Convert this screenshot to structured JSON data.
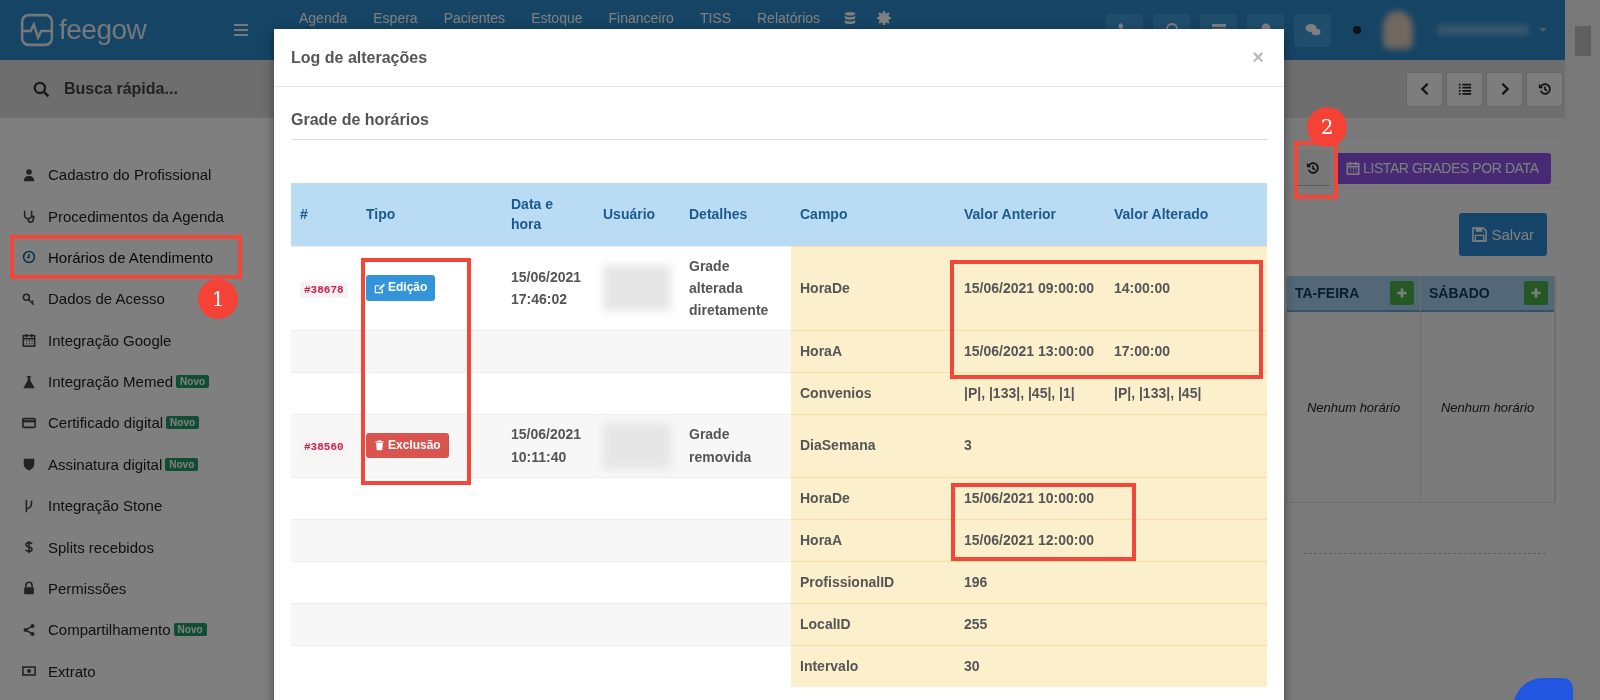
{
  "header": {
    "logo": "feegow",
    "nav": [
      "Agenda",
      "Espera",
      "Pacientes",
      "Estoque",
      "Financeiro",
      "TISS",
      "Relatórios"
    ]
  },
  "search": {
    "placeholder": "Busca rápida..."
  },
  "sidebar": {
    "items": [
      {
        "label": "Cadastro do Profissional",
        "selected": false
      },
      {
        "label": "Procedimentos da Agenda",
        "selected": false
      },
      {
        "label": "Horários de Atendimento",
        "selected": true
      },
      {
        "label": "Dados de Acesso",
        "selected": false
      },
      {
        "label": "Integração Google",
        "selected": false
      },
      {
        "label": "Integração Memed",
        "selected": false,
        "badge": "Novo"
      },
      {
        "label": "Certificado digital",
        "selected": false,
        "badge": "Novo"
      },
      {
        "label": "Assinatura digital",
        "selected": false,
        "badge": "Novo"
      },
      {
        "label": "Integração Stone",
        "selected": false
      },
      {
        "label": "Splits recebidos",
        "selected": false
      },
      {
        "label": "Permissões",
        "selected": false
      },
      {
        "label": "Compartilhamento",
        "selected": false,
        "badge": "Novo"
      },
      {
        "label": "Extrato",
        "selected": false
      }
    ]
  },
  "page": {
    "list_button": "LISTAR GRADES POR DATA",
    "save_button": "Salvar",
    "days": [
      {
        "label": "TA-FEIRA",
        "empty": "Nenhum horário"
      },
      {
        "label": "SÁBADO",
        "empty": "Nenhum horário"
      }
    ]
  },
  "modal": {
    "title": "Log de alterações",
    "close": "×",
    "section": "Grade de horários",
    "columns": [
      "#",
      "Tipo",
      "Data e hora",
      "Usuário",
      "Detalhes",
      "Campo",
      "Valor Anterior",
      "Valor Alterado"
    ],
    "entries": [
      {
        "id": "#38678",
        "kind": "edit",
        "type": "Edição",
        "datetime": "15/06/2021 17:46:02",
        "details": "Grade alterada diretamente",
        "changes": [
          {
            "field": "HoraDe",
            "old": "15/06/2021 09:00:00",
            "new": "14:00:00"
          },
          {
            "field": "HoraA",
            "old": "15/06/2021 13:00:00",
            "new": "17:00:00"
          },
          {
            "field": "Convenios",
            "old": "|P|, |133|, |45|, |1|",
            "new": "|P|, |133|, |45|"
          }
        ]
      },
      {
        "id": "#38560",
        "kind": "delete",
        "type": "Exclusão",
        "datetime": "15/06/2021 10:11:40",
        "details": "Grade removida",
        "changes": [
          {
            "field": "DiaSemana",
            "old": "3"
          },
          {
            "field": "HoraDe",
            "old": "15/06/2021 10:00:00"
          },
          {
            "field": "HoraA",
            "old": "15/06/2021 12:00:00"
          },
          {
            "field": "ProfissionalID",
            "old": "196"
          },
          {
            "field": "LocalID",
            "old": "255"
          },
          {
            "field": "Intervalo",
            "old": "30"
          }
        ]
      }
    ]
  },
  "annotations": [
    {
      "label": "1"
    },
    {
      "label": "2"
    }
  ]
}
